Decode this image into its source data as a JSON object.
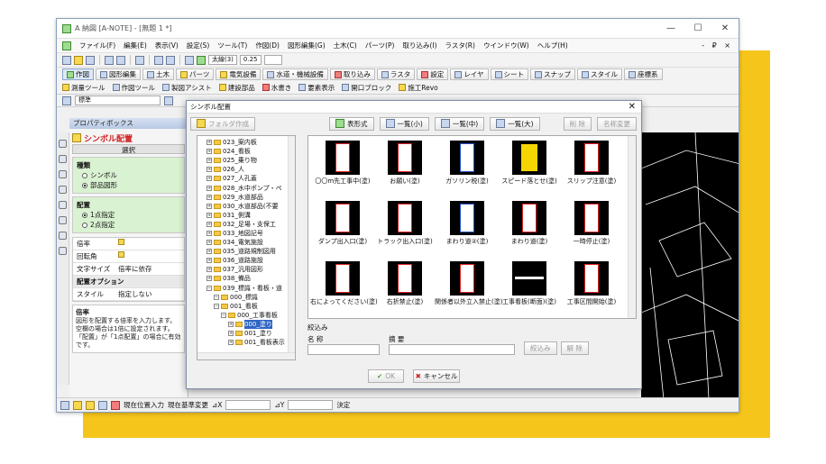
{
  "app": {
    "title": "A 納図 [A-NOTE] - [無題 1 *]",
    "controls": [
      "—",
      "☐",
      "✕"
    ],
    "mdi_controls": "- ₽ ×"
  },
  "menu": [
    "ファイル(F)",
    "編集(E)",
    "表示(V)",
    "設定(S)",
    "ツール(T)",
    "作図(D)",
    "図形編集(G)",
    "土木(C)",
    "パーツ(P)",
    "取り込み(I)",
    "ラスタ(R)",
    "ウインドウ(W)",
    "ヘルプ(H)"
  ],
  "toolbar": {
    "line_label": "太線(3)",
    "scale": "0.25"
  },
  "tabs": [
    "作図",
    "図形編集",
    "土木",
    "パーツ",
    "電気設備",
    "水道・機械設備",
    "取り込み",
    "ラスタ",
    "設定",
    "レイヤ",
    "シート",
    "スナップ",
    "スタイル",
    "座標系"
  ],
  "tabs2": [
    "測量ツール",
    "作図ツール",
    "製図アシスト",
    "建設部品",
    "水書き",
    "要素表示",
    "開口ブロック",
    "施工Revo"
  ],
  "layer_combo": "標準",
  "property": {
    "title": "プロパティボックス",
    "symbol_title": "シンボル配置",
    "select_label": "選択",
    "type_group": "種類",
    "type_opts": [
      "シンボル",
      "部品図形"
    ],
    "place_group": "配置",
    "place_opts": [
      "1点指定",
      "2点指定"
    ],
    "rows": [
      {
        "k": "倍率",
        "v": ""
      },
      {
        "k": "回転角",
        "v": ""
      },
      {
        "k": "文字サイズ",
        "v": "倍率に依存"
      }
    ],
    "option_title": "配置オプション",
    "option_rows": [
      {
        "k": "スタイル",
        "v": "指定しない"
      }
    ],
    "info_title": "倍率",
    "info_lines": [
      "図形を配置する倍率を入力します。",
      "空欄の場合は1倍に設定されます。",
      "「配置」が「1点配置」の場合に有効です。"
    ]
  },
  "status": {
    "mode1": "現在位置入力",
    "mode2": "現在基準変更",
    "dx": "⊿X",
    "dy": "⊿Y",
    "confirm": "決定"
  },
  "dialog": {
    "title": "シンボル配置",
    "folder_btn": "フォルダ作成",
    "view_btns": [
      "表形式",
      "一覧(小)",
      "一覧(中)",
      "一覧(大)"
    ],
    "delete_btn": "削 除",
    "rename_btn": "名称変更",
    "tree": [
      "023_案内板",
      "024_看板",
      "025_乗り物",
      "026_人",
      "027_人孔蓋",
      "028_水中ポンプ・ペ",
      "029_水道部品",
      "030_水道部品(不要",
      "031_側溝",
      "032_足場・支保工",
      "033_地図記号",
      "034_電気施設",
      "035_道路規制図用",
      "036_道路施設",
      "037_汎用図形",
      "038_備品",
      "039_標識・看板・道",
      "000_標識",
      "001_看板",
      "000_工事看板",
      "000_塗り",
      "001_塗り",
      "001_看板表示"
    ],
    "items": [
      "〇〇m先工事中(塗)",
      "お願い(塗)",
      "ガソリン税(塗)",
      "スピード落とせ(塗)",
      "スリップ注意(塗)",
      "ダンプ出入口(塗)",
      "トラック出入口(塗)",
      "まわり道②(塗)",
      "まわり道(塗)",
      "一時停止(塗)",
      "右によってください(塗)",
      "右折禁止(塗)",
      "関係者以外立入禁止(塗)",
      "工事看板(断面)(塗)",
      "工事区間開始(塗)"
    ],
    "filter_title": "絞込み",
    "filter_name": "名 称",
    "filter_desc": "摘 要",
    "filter_btn": "絞込み",
    "clear_btn": "解 除",
    "ok": "OK",
    "cancel": "キャンセル"
  }
}
